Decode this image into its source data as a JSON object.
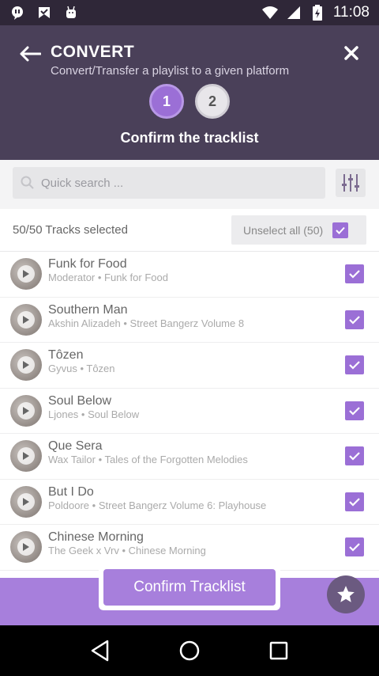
{
  "status_bar": {
    "time": "11:08"
  },
  "header": {
    "title": "CONVERT",
    "subtitle": "Convert/Transfer a playlist to a given platform",
    "steps": [
      "1",
      "2"
    ],
    "step_label": "Confirm the tracklist"
  },
  "search": {
    "placeholder": "Quick search ..."
  },
  "selection": {
    "count_label": "50/50 Tracks selected",
    "unselect_label": "Unselect all (50)"
  },
  "tracks": [
    {
      "title": "Funk for Food",
      "subtitle": "Moderator • Funk for Food"
    },
    {
      "title": "Southern Man",
      "subtitle": "Akshin Alizadeh • Street Bangerz Volume 8"
    },
    {
      "title": "Tôzen",
      "subtitle": "Gyvus • Tôzen"
    },
    {
      "title": "Soul Below",
      "subtitle": "Ljones • Soul Below"
    },
    {
      "title": "Que Sera",
      "subtitle": "Wax Tailor • Tales of the Forgotten Melodies"
    },
    {
      "title": "But I Do",
      "subtitle": "Poldoore • Street Bangerz Volume 6: Playhouse"
    },
    {
      "title": "Chinese Morning",
      "subtitle": "The Geek x Vrv • Chinese Morning"
    }
  ],
  "confirm_button": "Confirm Tracklist",
  "colors": {
    "accent": "#a77fdc",
    "header": "#4a4059",
    "status": "#2f2738"
  }
}
